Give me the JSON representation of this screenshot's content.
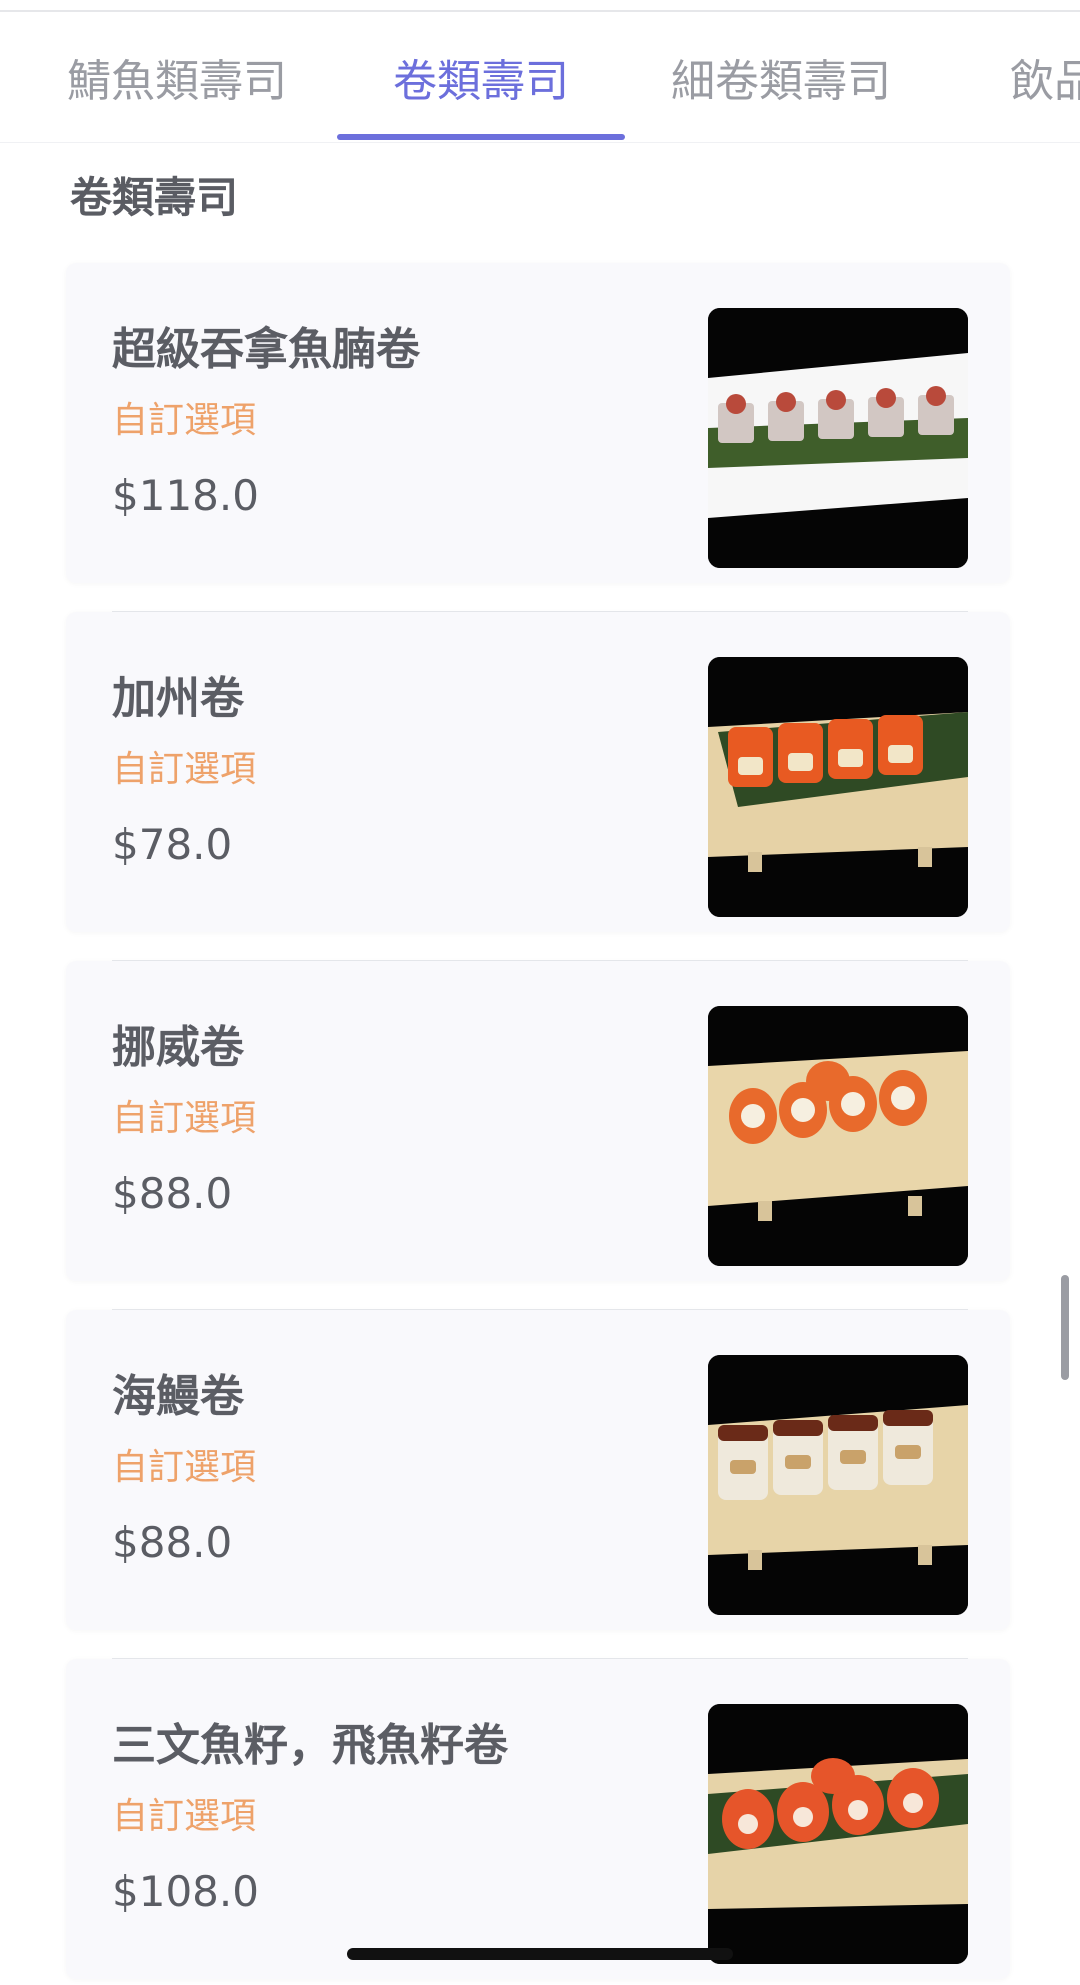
{
  "tabs": [
    {
      "label": "鯖魚類壽司",
      "active": false
    },
    {
      "label": "卷類壽司",
      "active": true
    },
    {
      "label": "細卷類壽司",
      "active": false
    },
    {
      "label": "飲品",
      "active": false
    }
  ],
  "section": {
    "title": "卷類壽司"
  },
  "items": [
    {
      "name": "超級吞拿魚腩卷",
      "option": "自訂選項",
      "price": "$118.0",
      "image_icon": "sushi-photo-icon"
    },
    {
      "name": "加州卷",
      "option": "自訂選項",
      "price": "$78.0",
      "image_icon": "sushi-photo-icon"
    },
    {
      "name": "挪威卷",
      "option": "自訂選項",
      "price": "$88.0",
      "image_icon": "sushi-photo-icon"
    },
    {
      "name": "海鰻卷",
      "option": "自訂選項",
      "price": "$88.0",
      "image_icon": "sushi-photo-icon"
    },
    {
      "name": "三文魚籽，飛魚籽卷",
      "option": "自訂選項",
      "price": "$108.0",
      "image_icon": "sushi-photo-icon"
    }
  ],
  "colors": {
    "accent": "#6c6fdc",
    "option": "#eea26a",
    "text": "#5b5d64",
    "tab_inactive": "#9a9ca3",
    "card_bg": "#f9f9fc"
  }
}
